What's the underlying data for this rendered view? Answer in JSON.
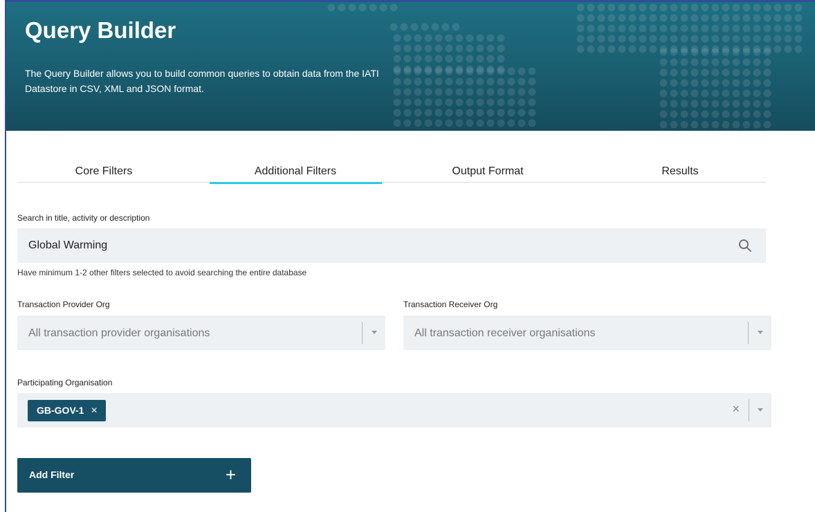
{
  "header": {
    "title": "Query Builder",
    "description": "The Query Builder allows you to build common queries to obtain data from the IATI Datastore in CSV, XML and JSON format."
  },
  "tabs": [
    {
      "label": "Core Filters",
      "active": false
    },
    {
      "label": "Additional Filters",
      "active": true
    },
    {
      "label": "Output Format",
      "active": false
    },
    {
      "label": "Results",
      "active": false
    }
  ],
  "search": {
    "label": "Search in title, activity or description",
    "value": "Global Warming",
    "hint": "Have minimum 1-2 other filters selected to avoid searching the entire database",
    "icon": "search-icon"
  },
  "provider_org": {
    "label": "Transaction Provider Org",
    "placeholder": "All transaction provider organisations"
  },
  "receiver_org": {
    "label": "Transaction Receiver Org",
    "placeholder": "All transaction receiver organisations"
  },
  "participating_org": {
    "label": "Participating Organisation",
    "chips": [
      {
        "value": "GB-GOV-1",
        "remove": "×"
      }
    ],
    "clear": "×"
  },
  "add_filter": {
    "label": "Add Filter",
    "icon": "+"
  },
  "colors": {
    "header_bg": "#1a5d70",
    "tab_underline": "#2ec8e0",
    "button_bg": "#164f63",
    "input_bg": "#eef1f4"
  }
}
